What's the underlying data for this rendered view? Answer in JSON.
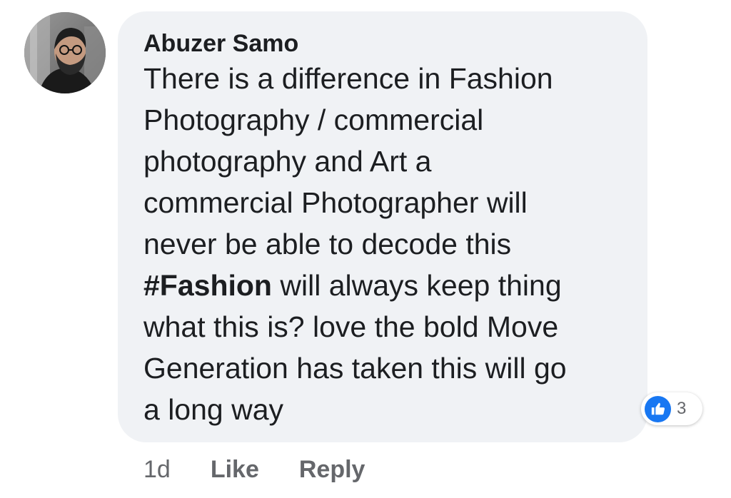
{
  "comment": {
    "author": "Abuzer Samo",
    "text_lines": [
      "There is a difference in Fashion",
      "Photography / commercial",
      "photography and Art a",
      "commercial Photographer will",
      "never be able to decode this"
    ],
    "hashtag": "#Fashion",
    "hashtag_line_rest": " will always keep thing",
    "text_lines_after": [
      "what this is? love the bold Move",
      "Generation has taken this will go",
      "a long way"
    ],
    "reaction_icon": "thumbs-up-icon",
    "reaction_count": "3",
    "timestamp": "1d",
    "like_label": "Like",
    "reply_label": "Reply"
  },
  "colors": {
    "bubble": "#f0f2f5",
    "text": "#1c1e21",
    "muted": "#65676b",
    "like_blue": "#1877f2"
  }
}
